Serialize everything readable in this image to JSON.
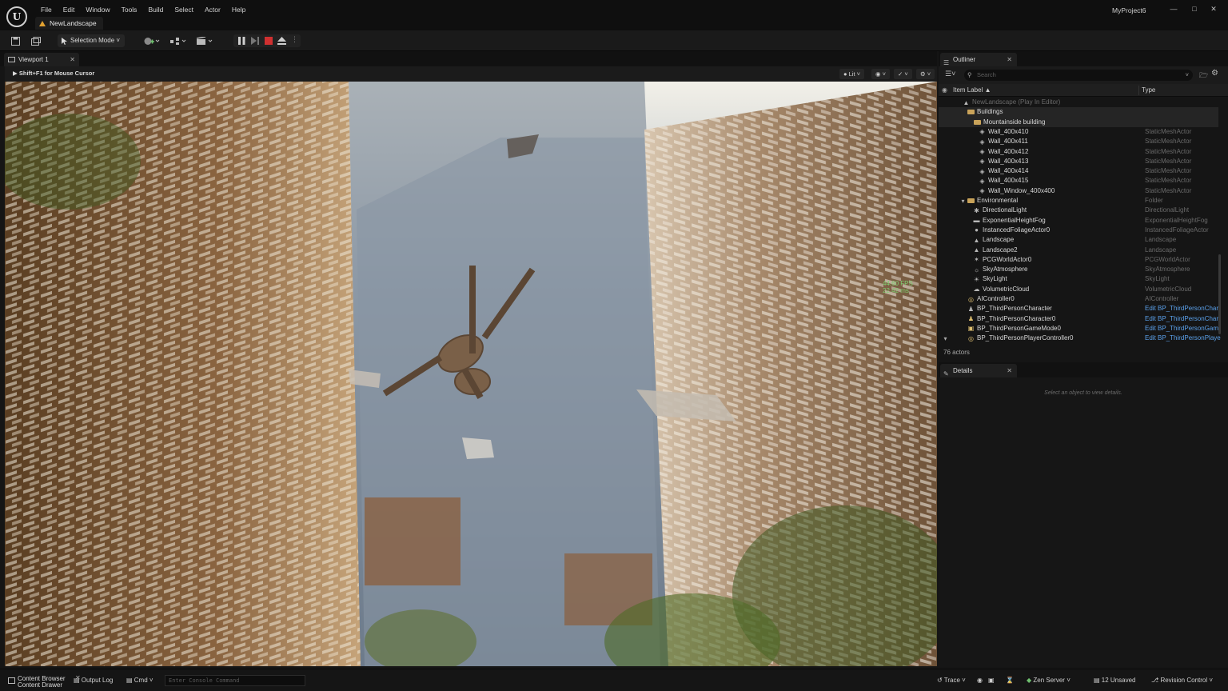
{
  "app": {
    "project_name": "MyProject6",
    "document_tab": "NewLandscape",
    "menu": [
      "File",
      "Edit",
      "Window",
      "Tools",
      "Build",
      "Select",
      "Actor",
      "Help"
    ]
  },
  "toolbar": {
    "selection_mode": "Selection Mode"
  },
  "viewport": {
    "tab_label": "Viewport 1",
    "hint": "Shift+F1 for Mouse Cursor",
    "view_mode": "Lit",
    "fps_line1": "44.60 FPS",
    "fps_line2": "22.42 ms"
  },
  "outliner": {
    "tab_label": "Outliner",
    "search_placeholder": "Search",
    "col_label": "Item Label ▲",
    "col_type": "Type",
    "rows": [
      {
        "label": "NewLandscape (Play In Editor)",
        "type": ""
      },
      {
        "label": "Buildings",
        "type": ""
      },
      {
        "label": "Mountainside building",
        "type": ""
      },
      {
        "label": "Wall_400x410",
        "type": "StaticMeshActor"
      },
      {
        "label": "Wall_400x411",
        "type": "StaticMeshActor"
      },
      {
        "label": "Wall_400x412",
        "type": "StaticMeshActor"
      },
      {
        "label": "Wall_400x413",
        "type": "StaticMeshActor"
      },
      {
        "label": "Wall_400x414",
        "type": "StaticMeshActor"
      },
      {
        "label": "Wall_400x415",
        "type": "StaticMeshActor"
      },
      {
        "label": "Wall_Window_400x400",
        "type": "StaticMeshActor"
      },
      {
        "label": "Environmental",
        "type": "Folder"
      },
      {
        "label": "DirectionalLight",
        "type": "DirectionalLight"
      },
      {
        "label": "ExponentialHeightFog",
        "type": "ExponentialHeightFog"
      },
      {
        "label": "InstancedFoliageActor0",
        "type": "InstancedFoliageActor"
      },
      {
        "label": "Landscape",
        "type": "Landscape"
      },
      {
        "label": "Landscape2",
        "type": "Landscape"
      },
      {
        "label": "PCGWorldActor0",
        "type": "PCGWorldActor"
      },
      {
        "label": "SkyAtmosphere",
        "type": "SkyAtmosphere"
      },
      {
        "label": "SkyLight",
        "type": "SkyLight"
      },
      {
        "label": "VolumetricCloud",
        "type": "VolumetricCloud"
      },
      {
        "label": "AIController0",
        "type": "AIController"
      },
      {
        "label": "BP_ThirdPersonCharacter",
        "type": "Edit BP_ThirdPersonChar"
      },
      {
        "label": "BP_ThirdPersonCharacter0",
        "type": "Edit BP_ThirdPersonChar"
      },
      {
        "label": "BP_ThirdPersonGameMode0",
        "type": "Edit BP_ThirdPersonGam"
      },
      {
        "label": "BP_ThirdPersonPlayerController0",
        "type": "Edit BP_ThirdPersonPlaye"
      }
    ],
    "actor_count": "76 actors"
  },
  "details": {
    "tab_label": "Details",
    "empty_hint": "Select an object to view details."
  },
  "statusbar": {
    "content_browser": "Content Browser",
    "content_drawer": "Content Drawer",
    "output_log": "Output Log",
    "cmd": "Cmd",
    "console_placeholder": "Enter Console Command",
    "trace": "Trace",
    "zen_server": "Zen Server",
    "unsaved": "12 Unsaved",
    "revision_control": "Revision Control"
  },
  "colors": {
    "panel_bg": "#151515",
    "accent_link": "#5aa0ea",
    "stop_red": "#d03030",
    "folder": "#c9a35a",
    "fps_green": "#7fcf70"
  }
}
